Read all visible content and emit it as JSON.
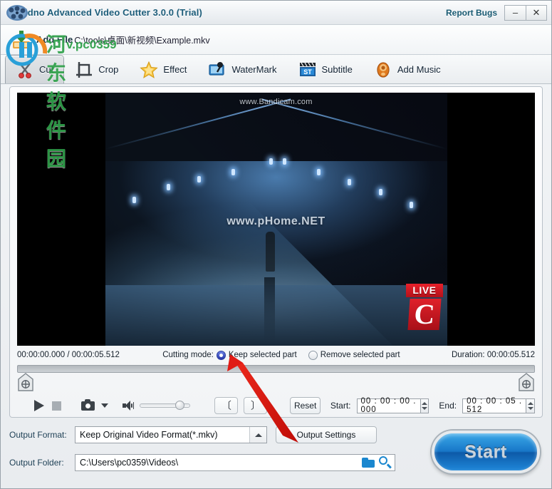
{
  "window": {
    "title": "idno Advanced Video Cutter 3.0.0 (Trial)",
    "report_bugs": "Report Bugs",
    "minimize": "–",
    "close": "✕",
    "logo_icon": "film-reel-icon"
  },
  "filebar": {
    "add_file_label": "Add File",
    "add_file_icon": "add-file-icon",
    "file_path": "C:\\tools\\桌面\\新视频\\Example.mkv"
  },
  "tabs": [
    {
      "label": "Cut",
      "icon": "scissors-icon",
      "active": true
    },
    {
      "label": "Crop",
      "icon": "crop-icon",
      "active": false
    },
    {
      "label": "Effect",
      "icon": "star-icon",
      "active": false
    },
    {
      "label": "WaterMark",
      "icon": "watermark-icon",
      "active": false
    },
    {
      "label": "Subtitle",
      "icon": "clapboard-st-icon",
      "active": false
    },
    {
      "label": "Add Music",
      "icon": "speaker-icon",
      "active": false
    }
  ],
  "preview": {
    "top_watermark": "www.Bandicam.com",
    "center_watermark": "www.pHome.NET",
    "live_badge": "LIVE",
    "channel_logo": "C"
  },
  "timeline": {
    "position_of_total": "00:00:00.000 / 00:00:05.512",
    "cutting_mode_label": "Cutting mode:",
    "mode_keep": "Keep selected part",
    "mode_remove": "Remove selected part",
    "mode_selected": "Keep selected part",
    "duration": "Duration: 00:00:05.512",
    "handle_left_icon": "trim-start-handle-icon",
    "handle_right_icon": "trim-end-handle-icon"
  },
  "controls": {
    "play_icon": "play-icon",
    "stop_icon": "stop-icon",
    "snapshot_icon": "camera-icon",
    "snapshot_menu_icon": "chevron-down-icon",
    "volume_icon": "speaker-volume-icon",
    "volume_percent": 80,
    "mark_in": "〔",
    "mark_out": "〕",
    "reset_label": "Reset",
    "start_label": "Start:",
    "start_value": "00 : 00 : 00 . 000",
    "end_label": "End:",
    "end_value": "00 : 00 : 05 . 512"
  },
  "output": {
    "format_label": "Output Format:",
    "format_value": "Keep Original Video Format(*.mkv)",
    "format_dropdown_icon": "chevron-up-icon",
    "settings_button": "Output Settings",
    "folder_label": "Output Folder:",
    "folder_value": "C:\\Users\\pc0359\\Videos\\",
    "folder_browse_icon": "folder-icon",
    "folder_search_icon": "search-icon"
  },
  "action": {
    "start_button": "Start"
  },
  "watermark": {
    "site_cn": "河东软件园",
    "site_url": "v.pc0359",
    "mark_icon": "watermark-logo-icon"
  },
  "annotation": {
    "arrow_icon": "red-arrow-annotation"
  },
  "colors": {
    "title_text": "#1d5d7a",
    "accent_blue": "#1877c8",
    "radio_selected": "#2434a8",
    "live_red": "#d0161f",
    "watermark_green": "#2fa14a",
    "arrow_red": "#e01b15"
  }
}
